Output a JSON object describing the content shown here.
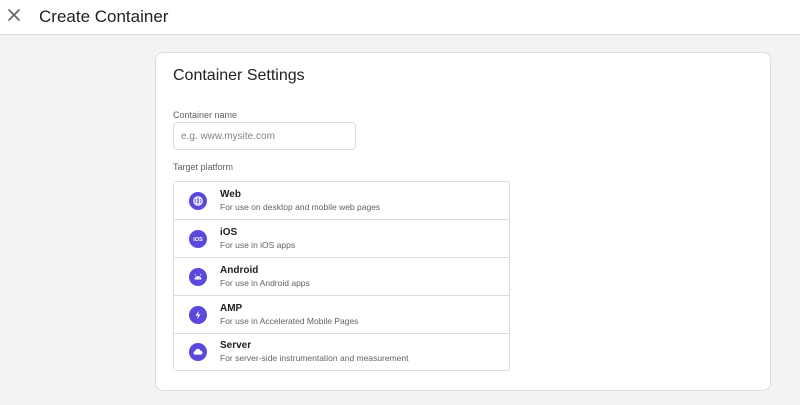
{
  "header": {
    "title": "Create Container",
    "close_icon": "close-icon"
  },
  "card": {
    "title": "Container Settings",
    "name_field": {
      "label": "Container name",
      "placeholder": "e.g. www.mysite.com",
      "value": ""
    },
    "platform_label": "Target platform",
    "platforms": [
      {
        "name": "Web",
        "description": "For use on desktop and mobile web pages",
        "icon": "globe-icon"
      },
      {
        "name": "iOS",
        "description": "For use in iOS apps",
        "icon": "ios-icon"
      },
      {
        "name": "Android",
        "description": "For use in Android apps",
        "icon": "android-icon"
      },
      {
        "name": "AMP",
        "description": "For use in Accelerated Mobile Pages",
        "icon": "bolt-icon"
      },
      {
        "name": "Server",
        "description": "For server-side instrumentation and measurement",
        "icon": "cloud-icon"
      }
    ]
  },
  "colors": {
    "accent": "#5b49db",
    "background": "#f1f3f4",
    "border": "#dadce0"
  }
}
